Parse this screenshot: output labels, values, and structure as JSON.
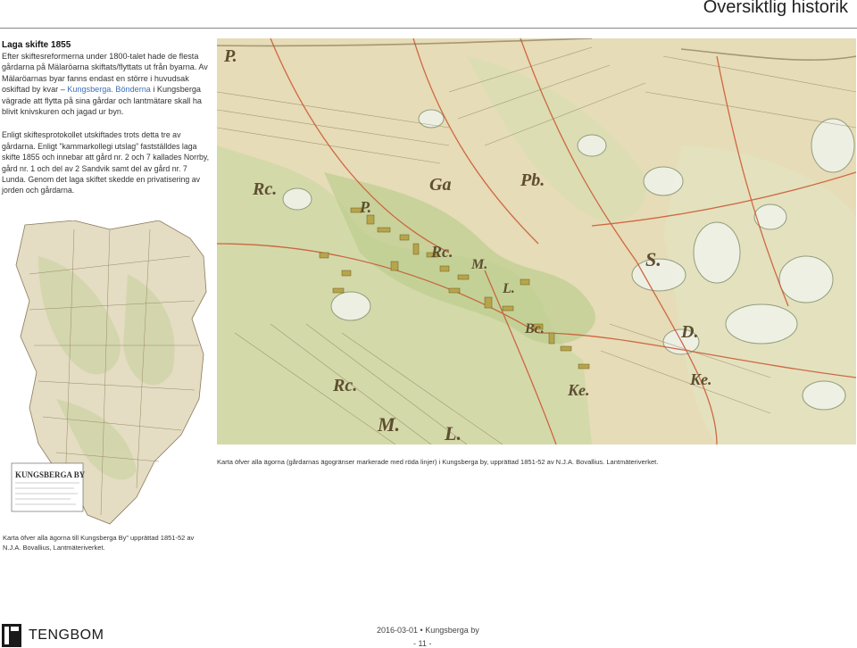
{
  "header": {
    "title": "Översiktlig historik"
  },
  "intro": {
    "heading": "Laga skifte 1855",
    "paragraph1_before": "Efter skiftesreformerna under 1800-talet hade de flesta gårdarna på Mälaröarna skiftats/flyttats ut från byarna. Av Mälaröarnas byar fanns endast en större i huvudsak oskiftad by kvar – ",
    "paragraph1_link": "Kungsberga. Bönderna",
    "paragraph1_after": " i Kungsberga vägrade att flytta på sina gårdar och lantmätare skall ha blivit knivskuren och jagad ur byn.",
    "paragraph2": "Enligt skiftesprotokollet utskiftades trots detta tre av gårdarna. Enligt ”kammarkollegi utslag” fastställdes laga skifte 1855 och innebar att gård nr. 2 och 7 kallades Norrby, gård nr. 1 och del av 2 Sandvik samt del av gård nr. 7 Lunda. Genom det laga skiftet skedde en privatisering av jorden och gårdarna."
  },
  "main_map": {
    "caption": "Karta öfver alla ägorna (gårdarnas ägogränser markerade med röda linjer) i Kungsberga by, upprättad 1851-52 av N.J.A. Bovallius. Lantmäteriverket.",
    "labels": [
      "P.",
      "Rc.",
      "Ga",
      "Pb.",
      "P.",
      "Rc.",
      "M.",
      "L.",
      "S.",
      "D.",
      "Bc.",
      "Rc.",
      "Ke.",
      "Ke.",
      "M.",
      "L."
    ],
    "colors": {
      "paper": "#e6dcb7",
      "meadow": "#c8d5a0",
      "rock": "#eef1e6",
      "boundary": "#c9542e",
      "ink": "#6a5a40"
    }
  },
  "left_map": {
    "title": "KUNGSBERGA BY",
    "caption": "Karta öfver alla ägorna till Kungsberga By” upprättad 1851-52 av N.J.A. Bovallius, Lantmäteriverket."
  },
  "footer": {
    "logo_text": "TENGBOM",
    "doc_info": "2016-03-01 • Kungsberga by",
    "page_number": "- 11 -"
  }
}
